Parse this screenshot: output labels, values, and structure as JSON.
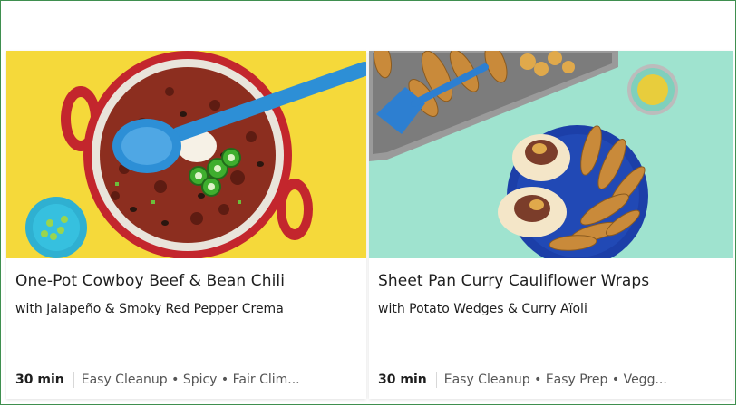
{
  "recipes": [
    {
      "title": "One-Pot Cowboy Beef & Bean Chili",
      "subtitle": "with Jalapeño & Smoky Red Pepper Crema",
      "time": "30 min",
      "tags": "Easy Cleanup • Spicy • Fair Clim...",
      "image_icon": "chili-pot-image"
    },
    {
      "title": "Sheet Pan Curry Cauliflower Wraps",
      "subtitle": "with Potato Wedges & Curry Aïoli",
      "time": "30 min",
      "tags": "Easy Cleanup • Easy Prep • Vegg...",
      "image_icon": "cauliflower-wraps-image"
    }
  ],
  "colors": {
    "frame_border": "#3f8f4f",
    "card_1_background": "#f5d93a",
    "card_2_background": "#9fe3cf"
  }
}
